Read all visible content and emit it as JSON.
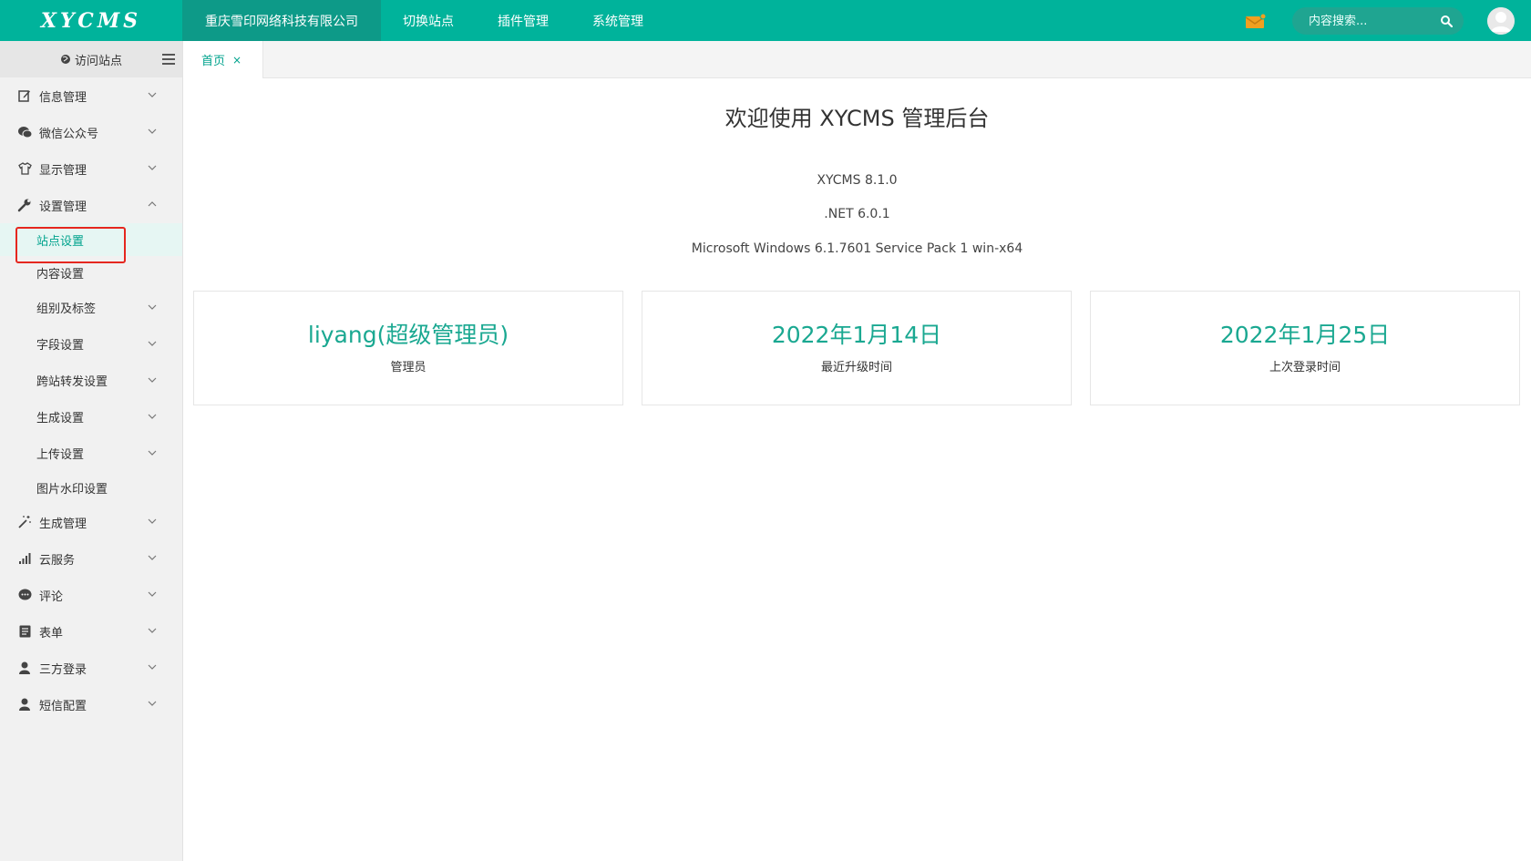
{
  "brand": {
    "logo_text": "XYCMS"
  },
  "topnav": {
    "items": [
      {
        "label": "重庆雪印网络科技有限公司",
        "active": true
      },
      {
        "label": "切换站点"
      },
      {
        "label": "插件管理"
      },
      {
        "label": "系统管理"
      }
    ]
  },
  "search": {
    "placeholder": "内容搜索..."
  },
  "colors": {
    "primary": "#00b39b",
    "accent": "#00a38d",
    "highlight": "#e5271f",
    "mail": "#f0a020"
  },
  "sidebar": {
    "visit_label": "访问站点",
    "menu": [
      {
        "label": "信息管理",
        "icon": "edit-icon"
      },
      {
        "label": "微信公众号",
        "icon": "wechat-icon"
      },
      {
        "label": "显示管理",
        "icon": "tshirt-icon"
      },
      {
        "label": "设置管理",
        "icon": "wrench-icon",
        "expanded": true
      }
    ],
    "submenu": [
      {
        "label": "站点设置",
        "active": true
      },
      {
        "label": "内容设置"
      },
      {
        "label": "组别及标签",
        "has_children": true
      },
      {
        "label": "字段设置",
        "has_children": true
      },
      {
        "label": "跨站转发设置",
        "has_children": true
      },
      {
        "label": "生成设置",
        "has_children": true
      },
      {
        "label": "上传设置",
        "has_children": true
      },
      {
        "label": "图片水印设置"
      }
    ],
    "menu2": [
      {
        "label": "生成管理",
        "icon": "magic-wand-icon"
      },
      {
        "label": "云服务",
        "icon": "signal-bars-icon"
      },
      {
        "label": "评论",
        "icon": "comment-icon"
      },
      {
        "label": "表单",
        "icon": "form-icon"
      },
      {
        "label": "三方登录",
        "icon": "user-icon"
      },
      {
        "label": "短信配置",
        "icon": "user-icon"
      }
    ]
  },
  "tabs": [
    {
      "label": "首页",
      "close": "×"
    }
  ],
  "main": {
    "title": "欢迎使用 XYCMS 管理后台",
    "versions": [
      "XYCMS 8.1.0",
      ".NET 6.0.1",
      "Microsoft Windows 6.1.7601 Service Pack 1 win-x64"
    ],
    "cards": [
      {
        "value": "liyang(超级管理员)",
        "label": "管理员"
      },
      {
        "value": "2022年1月14日",
        "label": "最近升级时间"
      },
      {
        "value": "2022年1月25日",
        "label": "上次登录时间"
      }
    ]
  }
}
